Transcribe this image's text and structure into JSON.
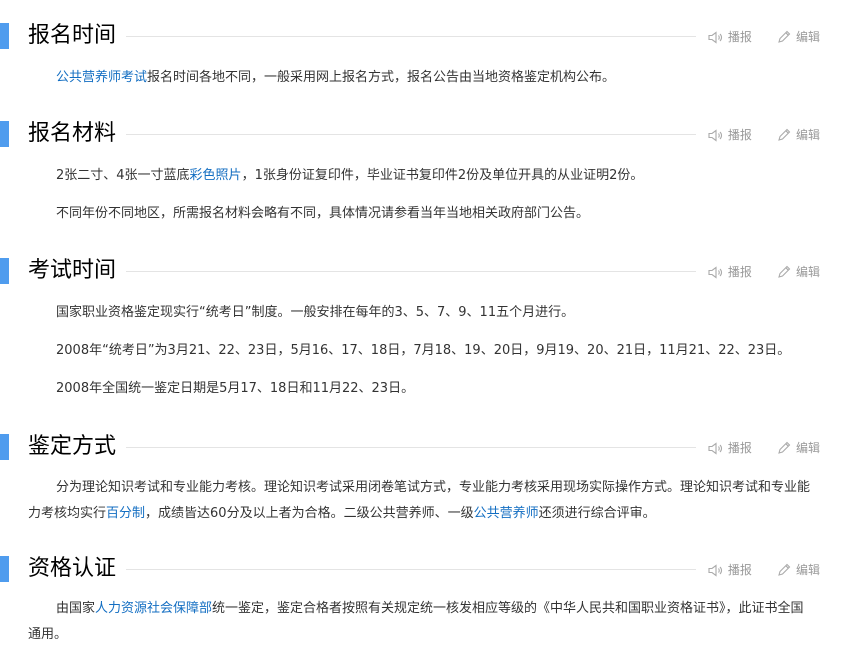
{
  "actions": {
    "read_label": "播报",
    "edit_label": "编辑"
  },
  "sections": [
    {
      "title": "报名时间",
      "paragraphs": [
        {
          "link1": "公共营养师考试",
          "text1": "报名时间各地不同，一般采用网上报名方式，报名公告由当地资格鉴定机构公布。"
        }
      ]
    },
    {
      "title": "报名材料",
      "paragraphs": [
        {
          "text1": "2张二寸、4张一寸蓝底",
          "link1": "彩色照片",
          "text2": "，1张身份证复印件，毕业证书复印件2份及单位开具的从业证明2份。"
        },
        {
          "text1": "不同年份不同地区，所需报名材料会略有不同，具体情况请参看当年当地相关政府部门公告。"
        }
      ]
    },
    {
      "title": "考试时间",
      "paragraphs": [
        {
          "text1": "国家职业资格鉴定现实行“统考日”制度。一般安排在每年的3、5、7、9、11五个月进行。"
        },
        {
          "text1": "2008年“统考日”为3月21、22、23日，5月16、17、18日，7月18、19、20日，9月19、20、21日，11月21、22、23日。"
        },
        {
          "text1": "2008年全国统一鉴定日期是5月17、18日和11月22、23日。"
        }
      ]
    },
    {
      "title": "鉴定方式",
      "paragraphs": [
        {
          "text1": "分为理论知识考试和专业能力考核。理论知识考试采用闭卷笔试方式，专业能力考核采用现场实际操作方式。理论知识考试和专业能力考核均实行",
          "link1": "百分制",
          "text2": "，成绩皆达60分及以上者为合格。二级公共营养师、一级",
          "link2": "公共营养师",
          "text3": "还须进行综合评审。"
        }
      ]
    },
    {
      "title": "资格认证",
      "paragraphs": [
        {
          "text1": "由国家",
          "link1": "人力资源社会保障部",
          "text2": "统一鉴定，鉴定合格者按照有关规定统一核发相应等级的《中华人民共和国职业资格证书》，此证书全国通用。"
        }
      ]
    }
  ]
}
